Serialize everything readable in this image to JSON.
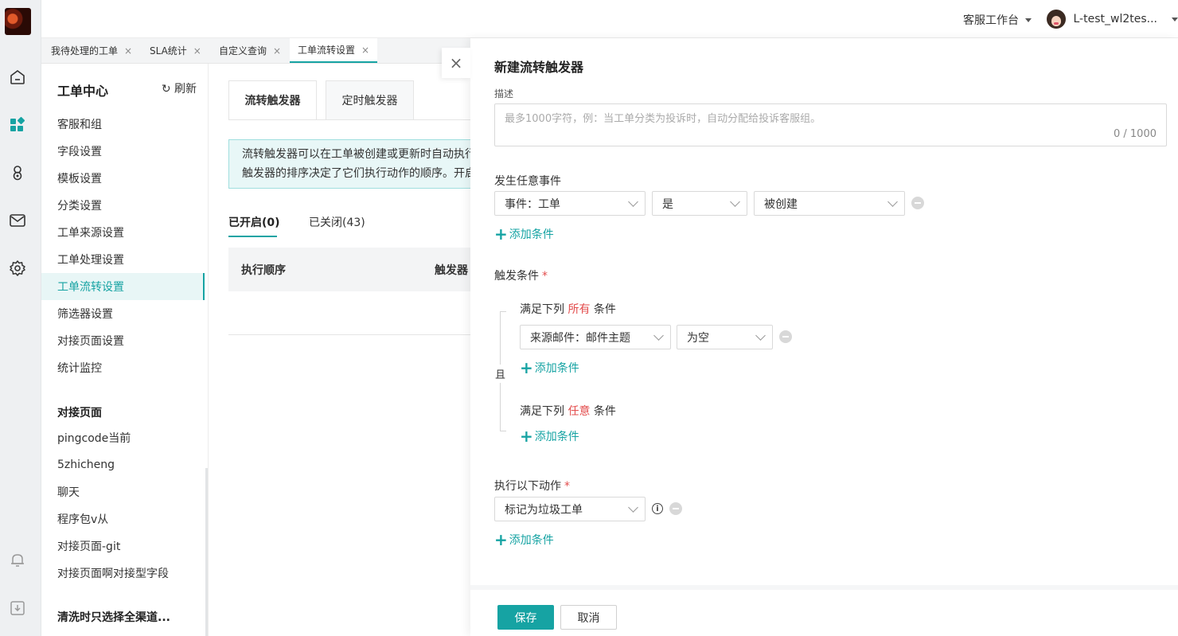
{
  "topbar": {
    "workspace": "客服工作台",
    "username": "L-test_wl2tes..."
  },
  "page_tabs": [
    {
      "label": "我待处理的工单",
      "close": "×"
    },
    {
      "label": "SLA统计",
      "close": "×"
    },
    {
      "label": "自定义查询",
      "close": "×"
    },
    {
      "label": "工单流转设置",
      "close": "×"
    }
  ],
  "sidebar": {
    "title": "工单中心",
    "refresh": "刷新",
    "items": [
      "客服和组",
      "字段设置",
      "模板设置",
      "分类设置",
      "工单来源设置",
      "工单处理设置",
      "工单流转设置",
      "筛选器设置",
      "对接页面设置",
      "统计监控"
    ],
    "section2_title": "对接页面",
    "section2_items": [
      "pingcode当前",
      "5zhicheng",
      "聊天",
      "程序包v从",
      "对接页面-git",
      "对接页面啊对接型字段"
    ],
    "section3_title": "清洗时只选择全渠道..."
  },
  "main": {
    "tabs": [
      "流转触发器",
      "定时触发器"
    ],
    "notice_line1": "流转触发器可以在工单被创建或更新时自动执行",
    "notice_line2": "触发器的排序决定了它们执行动作的顺序。开启",
    "status_tabs": [
      "已开启(0)",
      "已关闭(43)"
    ],
    "columns": [
      "执行顺序",
      "触发器"
    ]
  },
  "drawer": {
    "title": "新建流转触发器",
    "close": "×",
    "desc_label": "描述",
    "desc_placeholder": "最多1000字符，例：当工单分类为投诉时，自动分配给投诉客服组。",
    "desc_counter": "0 / 1000",
    "event_label": "发生任意事件",
    "event_field": "事件：工单",
    "event_op": "是",
    "event_value": "被创建",
    "add_condition": "添加条件",
    "trigger_label": "触发条件",
    "required_mark": "*",
    "all_prefix": "满足下列",
    "all_word": "所有",
    "any_word": "任意",
    "cond_suffix": "条件",
    "all_field": "来源邮件：邮件主题",
    "all_op": "为空",
    "and_label": "且",
    "action_label": "执行以下动作",
    "action_value": "标记为垃圾工单",
    "info_mark": "i",
    "save": "保存",
    "cancel": "取消"
  }
}
